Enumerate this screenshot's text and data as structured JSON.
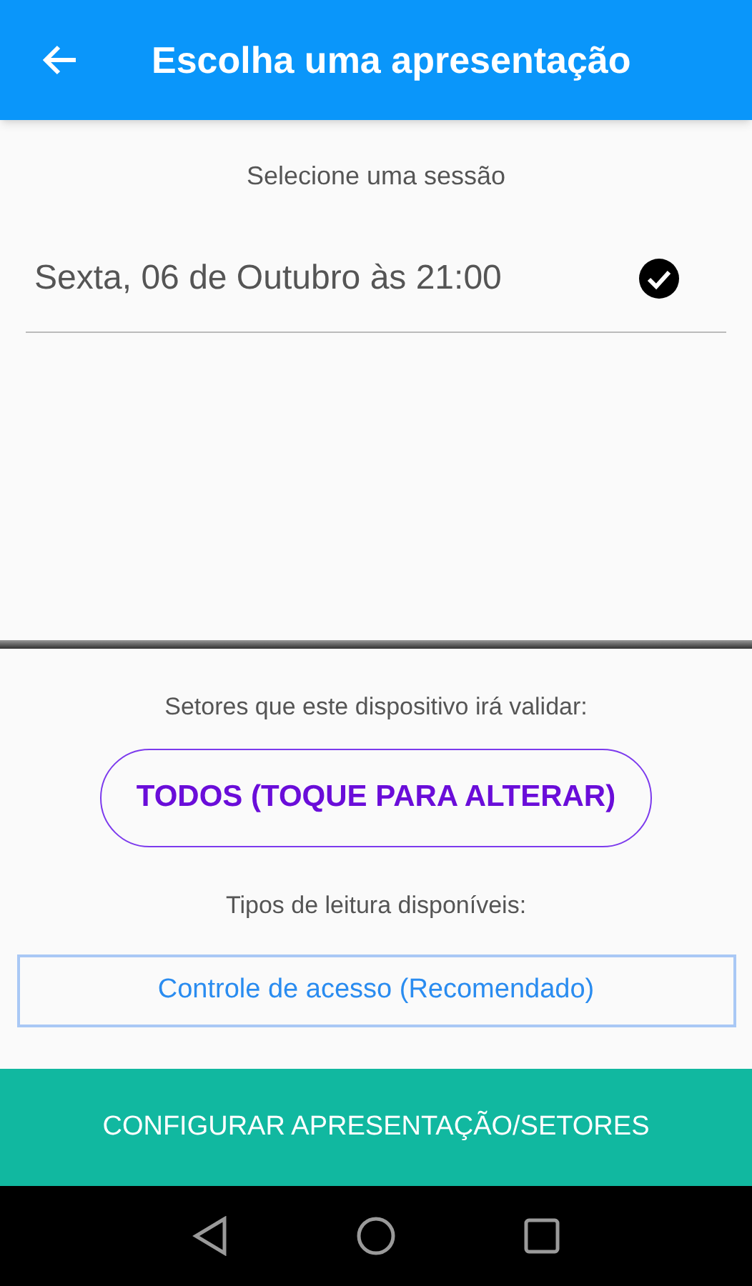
{
  "app_bar": {
    "title": "Escolha uma apresentação"
  },
  "sessions": {
    "label": "Selecione uma sessão",
    "items": [
      {
        "label": "Sexta, 06 de Outubro às 21:00",
        "selected": true
      }
    ]
  },
  "sectors": {
    "label": "Setores que este dispositivo irá validar:",
    "button": "TODOS (TOQUE PARA ALTERAR)"
  },
  "reading_types": {
    "label": "Tipos de leitura disponíveis:",
    "options": [
      "Controle de acesso (Recomendado)"
    ]
  },
  "primary_button": "CONFIGURAR APRESENTAÇÃO/SETORES"
}
